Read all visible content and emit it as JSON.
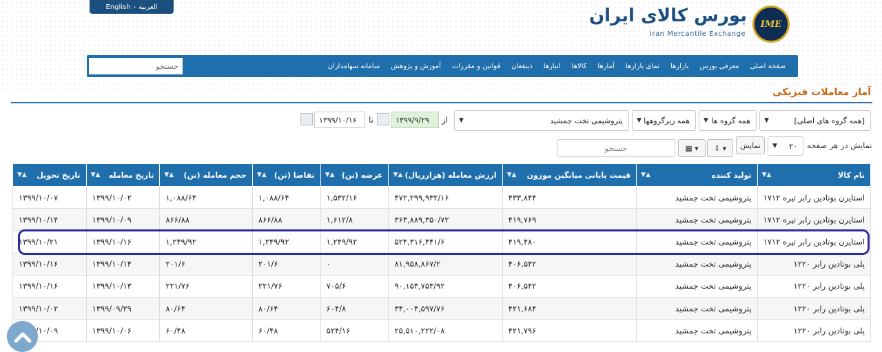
{
  "header": {
    "lang_en": "English",
    "lang_ar": "العربية",
    "logo_title": "بورس کالای ایران",
    "logo_subtitle": "Iran Mercantile Exchange",
    "logo_badge": "IME"
  },
  "nav": {
    "items": [
      "صفحه اصلی",
      "معرفی بورس",
      "بازارها",
      "نمای بازارها",
      "آمارها",
      "کالاها",
      "انبارها",
      "ذینفعان",
      "قوانین و مقررات",
      "آموزش و پژوهش",
      "سامانه سهامداران"
    ],
    "search_placeholder": "جستجو"
  },
  "page": {
    "title": "آمار معاملات فیزیکی"
  },
  "filters": {
    "main_group": "[همه گروه های اصلی]",
    "group": "همه گروه ها",
    "subgroup": "همه زیرگروهها",
    "producer": "پتروشیمی تخت جمشید",
    "from_label": "از",
    "from_date": "۱۳۹۹/۹/۲۹",
    "to_label": "تا",
    "to_date": "۱۳۹۹/۱۰/۱۶",
    "page_size_label": "نمایش در هر صفحه",
    "page_size": "۲۰",
    "show_button": "نمایش",
    "search_placeholder": "جستجو"
  },
  "table": {
    "headers": [
      "نام کالا",
      "تولید کننده",
      "قیمت پایانی میانگین موزون",
      "ارزش معامله (هزارریال)",
      "عرضه (تن)",
      "تقاضا (تن)",
      "حجم معامله (تن)",
      "تاریخ معامله",
      "تاریخ تحویل"
    ],
    "rows": [
      [
        "استایرن بوتادین رابر تیره ۱۷۱۲",
        "پتروشیمی تخت جمشید",
        "۴۳۳,۸۴۴",
        "۴۷۲,۲۹۹,۹۳۲/۱۶",
        "۱,۵۳۲/۱۶",
        "۱,۰۸۸/۶۴",
        "۱,۰۸۸/۶۴",
        "۱۳۹۹/۱۰/۰۲",
        "۱۳۹۹/۱۰/۰۷"
      ],
      [
        "استایرن بوتادین رابر تیره ۱۷۱۲",
        "پتروشیمی تخت جمشید",
        "۴۱۹,۷۶۹",
        "۳۶۳,۸۸۹,۳۵۰/۷۲",
        "۱,۶۱۲/۸",
        "۸۶۶/۸۸",
        "۸۶۶/۸۸",
        "۱۳۹۹/۱۰/۰۹",
        "۱۳۹۹/۱۰/۱۴"
      ],
      [
        "استایرن بوتادین رابر تیره ۱۷۱۲",
        "پتروشیمی تخت جمشید",
        "۴۱۹,۴۸۰",
        "۵۲۴,۳۱۶,۴۴۱/۶",
        "۱,۲۴۹/۹۲",
        "۱,۲۴۹/۹۲",
        "۱,۲۴۹/۹۲",
        "۱۳۹۹/۱۰/۱۶",
        "۱۳۹۹/۱۰/۲۱"
      ],
      [
        "پلی بوتادین رابر ۱۲۲۰",
        "پتروشیمی تخت جمشید",
        "۴۰۶,۵۴۲",
        "۸۱,۹۵۸,۸۶۷/۲",
        "۰",
        "۲۰۱/۶",
        "۲۰۱/۶",
        "۱۳۹۹/۱۰/۱۴",
        "۱۳۹۹/۱۰/۱۶"
      ],
      [
        "پلی بوتادین رابر ۱۲۲۰",
        "پتروشیمی تخت جمشید",
        "۴۰۶,۵۴۲",
        "۹۰,۱۵۴,۷۵۳/۹۲",
        "۷۰۵/۶",
        "۲۲۱/۷۶",
        "۲۲۱/۷۶",
        "۱۳۹۹/۱۰/۱۳",
        "۱۳۹۹/۱۰/۱۶"
      ],
      [
        "پلی بوتادین رابر ۱۲۲۰",
        "پتروشیمی تخت جمشید",
        "۴۲۱,۶۸۴",
        "۳۴,۰۰۴,۵۹۷/۷۶",
        "۶۰۴/۸",
        "۸۰/۶۴",
        "۸۰/۶۴",
        "۱۳۹۹/۰۹/۲۹",
        "۱۳۹۹/۱۰/۰۲"
      ],
      [
        "پلی بوتادین رابر ۱۲۲۰",
        "پتروشیمی تخت جمشید",
        "۴۲۱,۷۹۶",
        "۲۵,۵۱۰,۲۲۲/۰۸",
        "۵۲۴/۱۶",
        "۶۰/۴۸",
        "۶۰/۴۸",
        "۱۳۹۹/۱۰/۰۶",
        "۱۳۹۹/۱۰/۰۹"
      ]
    ]
  },
  "colors": {
    "nav": "#1f6fad",
    "title": "#c8640e",
    "highlight": "#2c2e9e"
  }
}
